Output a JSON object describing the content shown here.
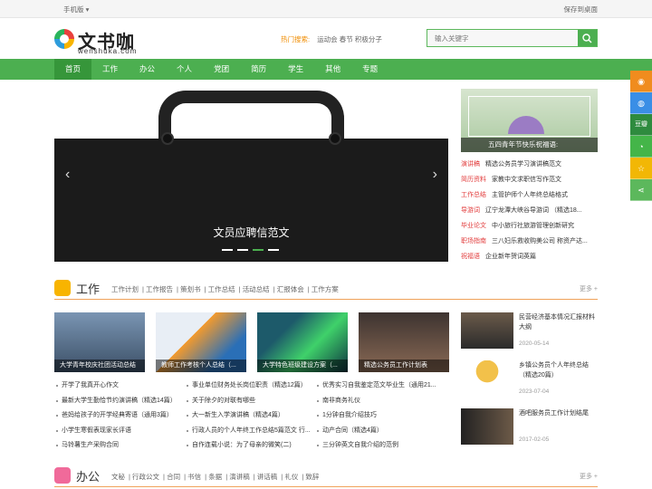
{
  "topbar": {
    "mobile": "手机版 ▾",
    "save_desktop": "保存到桌面"
  },
  "logo": {
    "cn": "文书咖",
    "en": "wenshuka.com"
  },
  "hot": {
    "label": "热门搜索:",
    "keywords": "运动会 春节 积极分子"
  },
  "search": {
    "placeholder": "输入关键字"
  },
  "nav": [
    "首页",
    "工作",
    "办公",
    "个人",
    "党团",
    "简历",
    "学生",
    "其他",
    "专题"
  ],
  "banner": {
    "caption": "文员应聘信范文"
  },
  "side_feature": {
    "caption": "五四青年节快乐祝福语:"
  },
  "side_list": [
    {
      "cat": "演讲稿",
      "title": "精选公务员学习演讲稿范文"
    },
    {
      "cat": "简历资料",
      "title": "家教中文求职信写作范文"
    },
    {
      "cat": "工作总结",
      "title": "主管护师个人年终总结格式"
    },
    {
      "cat": "导游词",
      "title": "辽宁龙潭大峡谷导游词 （精选18..."
    },
    {
      "cat": "毕业论文",
      "title": "中小旅行社旅游管理创新研究"
    },
    {
      "cat": "职场指南",
      "title": "三八妇乐救收购美公司 称资产达..."
    },
    {
      "cat": "祝福语",
      "title": "企业新年贺词英篇"
    }
  ],
  "work": {
    "title": "工作",
    "links": [
      "工作计划",
      "工作报告",
      "策划书",
      "工作总结",
      "活动总结",
      "汇报体会",
      "工作方案"
    ],
    "more": "更多 +",
    "thumbs": [
      "大学青年校庆社团活动总结",
      "教师工作考核个人总结（...",
      "大学特色班级建设方案（...",
      "精选公务员工作计划表"
    ],
    "col1": [
      "开学了我真开心作文",
      "最新大学生勤恰节约演讲稿（精选14篇）",
      "爸妈给孩子的开学经典寄语（通用3篇）",
      "小学生寒假表现家长评语",
      "马铃薯生产采购合同"
    ],
    "col2": [
      "事业单位财务处长岗位职责（精选12篇）",
      "关于除夕的对联有哪些",
      "大一新生入学演讲稿（精选4篇）",
      "行政人员的个人年终工作总结5篇范文 行...",
      "自作连载小说：为了母亲的微笑(二)"
    ],
    "col3": [
      "优秀实习自我鉴定范文毕业生（通用21...",
      "南非商务礼仪",
      "1分钟自我介绍技巧",
      "动产合同（精选4篇）",
      "三分钟英文自我介绍的范例"
    ],
    "right": [
      {
        "title": "民营经济基本情况汇报材料大纲",
        "date": "2020-05-14"
      },
      {
        "title": "乡镇公务员个人年终总结（精选20篇）",
        "date": "2023-07-04"
      },
      {
        "title": "酒吧服务员工作计划结尾",
        "date": "2017-02-05"
      }
    ]
  },
  "office": {
    "title": "办公",
    "links": [
      "文秘",
      "行政公文",
      "合同",
      "书信",
      "条据",
      "演讲稿",
      "讲话稿",
      "礼仪",
      "致辞"
    ],
    "more": "更多 +"
  },
  "float_icons": [
    "weibo-icon",
    "qq-icon",
    "douban-icon",
    "wechat-icon",
    "favorite-icon",
    "share-icon"
  ],
  "float_douban": "豆瓣",
  "colors": {
    "green": "#4caf50",
    "orange": "#f08c00",
    "red": "#e23c3c"
  }
}
